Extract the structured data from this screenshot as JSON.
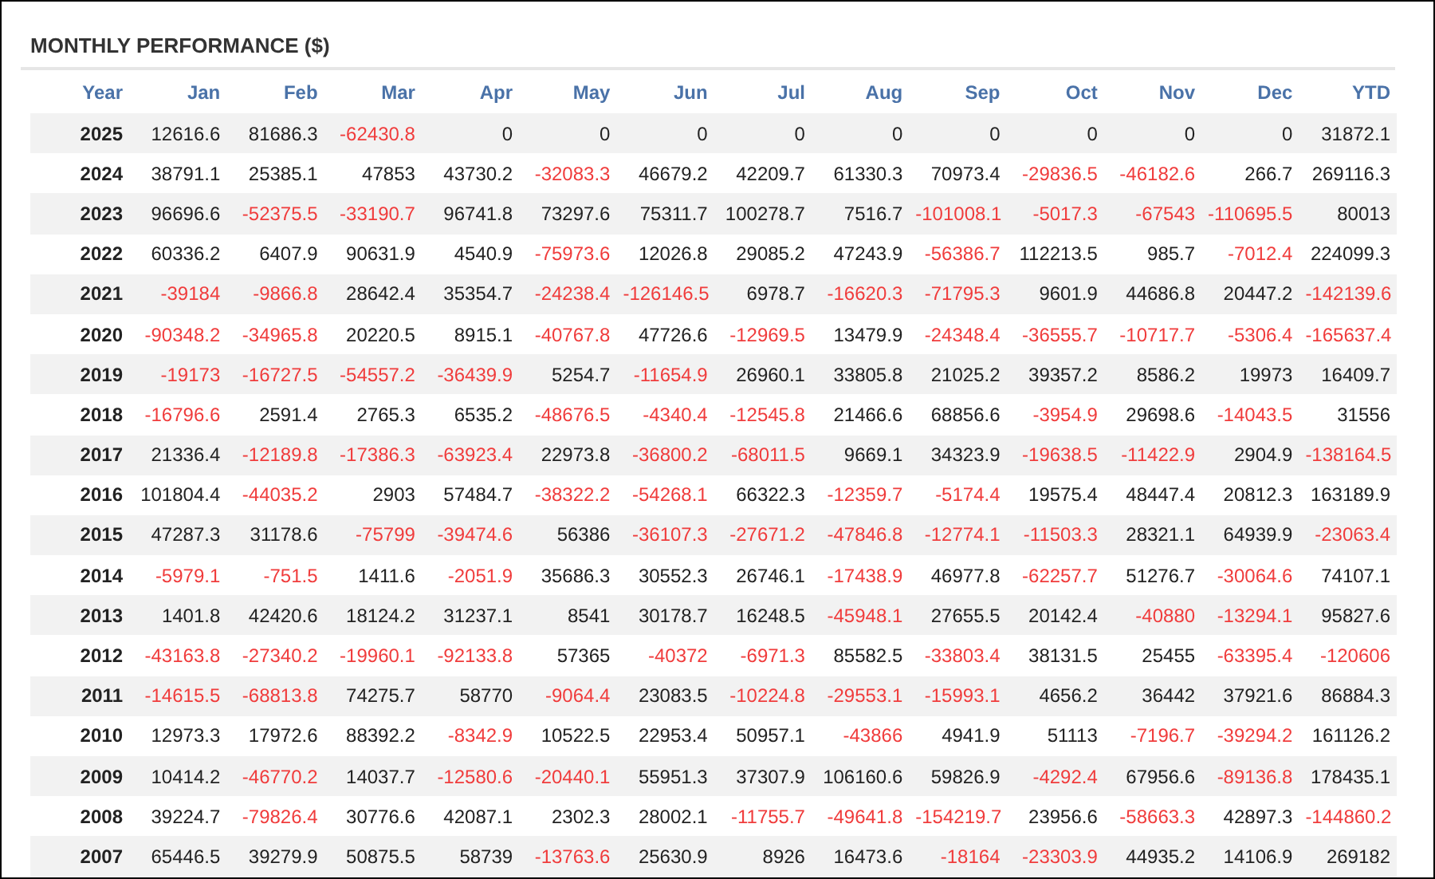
{
  "title": "MONTHLY PERFORMANCE ($)",
  "columns": [
    "Year",
    "Jan",
    "Feb",
    "Mar",
    "Apr",
    "May",
    "Jun",
    "Jul",
    "Aug",
    "Sep",
    "Oct",
    "Nov",
    "Dec",
    "YTD"
  ],
  "rows": [
    {
      "year": "2025",
      "cells": [
        {
          "text": "12616.6",
          "negative": false
        },
        {
          "text": "81686.3",
          "negative": false
        },
        {
          "text": "-62430.8",
          "negative": true
        },
        {
          "text": "0",
          "negative": false
        },
        {
          "text": "0",
          "negative": false
        },
        {
          "text": "0",
          "negative": false
        },
        {
          "text": "0",
          "negative": false
        },
        {
          "text": "0",
          "negative": false
        },
        {
          "text": "0",
          "negative": false
        },
        {
          "text": "0",
          "negative": false
        },
        {
          "text": "0",
          "negative": false
        },
        {
          "text": "0",
          "negative": false
        },
        {
          "text": "31872.1",
          "negative": false
        }
      ]
    },
    {
      "year": "2024",
      "cells": [
        {
          "text": "38791.1",
          "negative": false
        },
        {
          "text": "25385.1",
          "negative": false
        },
        {
          "text": "47853",
          "negative": false
        },
        {
          "text": "43730.2",
          "negative": false
        },
        {
          "text": "-32083.3",
          "negative": true
        },
        {
          "text": "46679.2",
          "negative": false
        },
        {
          "text": "42209.7",
          "negative": false
        },
        {
          "text": "61330.3",
          "negative": false
        },
        {
          "text": "70973.4",
          "negative": false
        },
        {
          "text": "-29836.5",
          "negative": true
        },
        {
          "text": "-46182.6",
          "negative": true
        },
        {
          "text": "266.7",
          "negative": false
        },
        {
          "text": "269116.3",
          "negative": false
        }
      ]
    },
    {
      "year": "2023",
      "cells": [
        {
          "text": "96696.6",
          "negative": false
        },
        {
          "text": "-52375.5",
          "negative": true
        },
        {
          "text": "-33190.7",
          "negative": true
        },
        {
          "text": "96741.8",
          "negative": false
        },
        {
          "text": "73297.6",
          "negative": false
        },
        {
          "text": "75311.7",
          "negative": false
        },
        {
          "text": "100278.7",
          "negative": false
        },
        {
          "text": "7516.7",
          "negative": false
        },
        {
          "text": "-101008.1",
          "negative": true
        },
        {
          "text": "-5017.3",
          "negative": true
        },
        {
          "text": "-67543",
          "negative": true
        },
        {
          "text": "-110695.5",
          "negative": true
        },
        {
          "text": "80013",
          "negative": false
        }
      ]
    },
    {
      "year": "2022",
      "cells": [
        {
          "text": "60336.2",
          "negative": false
        },
        {
          "text": "6407.9",
          "negative": false
        },
        {
          "text": "90631.9",
          "negative": false
        },
        {
          "text": "4540.9",
          "negative": false
        },
        {
          "text": "-75973.6",
          "negative": true
        },
        {
          "text": "12026.8",
          "negative": false
        },
        {
          "text": "29085.2",
          "negative": false
        },
        {
          "text": "47243.9",
          "negative": false
        },
        {
          "text": "-56386.7",
          "negative": true
        },
        {
          "text": "112213.5",
          "negative": false
        },
        {
          "text": "985.7",
          "negative": false
        },
        {
          "text": "-7012.4",
          "negative": true
        },
        {
          "text": "224099.3",
          "negative": false
        }
      ]
    },
    {
      "year": "2021",
      "cells": [
        {
          "text": "-39184",
          "negative": true
        },
        {
          "text": "-9866.8",
          "negative": true
        },
        {
          "text": "28642.4",
          "negative": false
        },
        {
          "text": "35354.7",
          "negative": false
        },
        {
          "text": "-24238.4",
          "negative": true
        },
        {
          "text": "-126146.5",
          "negative": true
        },
        {
          "text": "6978.7",
          "negative": false
        },
        {
          "text": "-16620.3",
          "negative": true
        },
        {
          "text": "-71795.3",
          "negative": true
        },
        {
          "text": "9601.9",
          "negative": false
        },
        {
          "text": "44686.8",
          "negative": false
        },
        {
          "text": "20447.2",
          "negative": false
        },
        {
          "text": "-142139.6",
          "negative": true
        }
      ]
    },
    {
      "year": "2020",
      "cells": [
        {
          "text": "-90348.2",
          "negative": true
        },
        {
          "text": "-34965.8",
          "negative": true
        },
        {
          "text": "20220.5",
          "negative": false
        },
        {
          "text": "8915.1",
          "negative": false
        },
        {
          "text": "-40767.8",
          "negative": true
        },
        {
          "text": "47726.6",
          "negative": false
        },
        {
          "text": "-12969.5",
          "negative": true
        },
        {
          "text": "13479.9",
          "negative": false
        },
        {
          "text": "-24348.4",
          "negative": true
        },
        {
          "text": "-36555.7",
          "negative": true
        },
        {
          "text": "-10717.7",
          "negative": true
        },
        {
          "text": "-5306.4",
          "negative": true
        },
        {
          "text": "-165637.4",
          "negative": true
        }
      ]
    },
    {
      "year": "2019",
      "cells": [
        {
          "text": "-19173",
          "negative": true
        },
        {
          "text": "-16727.5",
          "negative": true
        },
        {
          "text": "-54557.2",
          "negative": true
        },
        {
          "text": "-36439.9",
          "negative": true
        },
        {
          "text": "5254.7",
          "negative": false
        },
        {
          "text": "-11654.9",
          "negative": true
        },
        {
          "text": "26960.1",
          "negative": false
        },
        {
          "text": "33805.8",
          "negative": false
        },
        {
          "text": "21025.2",
          "negative": false
        },
        {
          "text": "39357.2",
          "negative": false
        },
        {
          "text": "8586.2",
          "negative": false
        },
        {
          "text": "19973",
          "negative": false
        },
        {
          "text": "16409.7",
          "negative": false
        }
      ]
    },
    {
      "year": "2018",
      "cells": [
        {
          "text": "-16796.6",
          "negative": true
        },
        {
          "text": "2591.4",
          "negative": false
        },
        {
          "text": "2765.3",
          "negative": false
        },
        {
          "text": "6535.2",
          "negative": false
        },
        {
          "text": "-48676.5",
          "negative": true
        },
        {
          "text": "-4340.4",
          "negative": true
        },
        {
          "text": "-12545.8",
          "negative": true
        },
        {
          "text": "21466.6",
          "negative": false
        },
        {
          "text": "68856.6",
          "negative": false
        },
        {
          "text": "-3954.9",
          "negative": true
        },
        {
          "text": "29698.6",
          "negative": false
        },
        {
          "text": "-14043.5",
          "negative": true
        },
        {
          "text": "31556",
          "negative": false
        }
      ]
    },
    {
      "year": "2017",
      "cells": [
        {
          "text": "21336.4",
          "negative": false
        },
        {
          "text": "-12189.8",
          "negative": true
        },
        {
          "text": "-17386.3",
          "negative": true
        },
        {
          "text": "-63923.4",
          "negative": true
        },
        {
          "text": "22973.8",
          "negative": false
        },
        {
          "text": "-36800.2",
          "negative": true
        },
        {
          "text": "-68011.5",
          "negative": true
        },
        {
          "text": "9669.1",
          "negative": false
        },
        {
          "text": "34323.9",
          "negative": false
        },
        {
          "text": "-19638.5",
          "negative": true
        },
        {
          "text": "-11422.9",
          "negative": true
        },
        {
          "text": "2904.9",
          "negative": false
        },
        {
          "text": "-138164.5",
          "negative": true
        }
      ]
    },
    {
      "year": "2016",
      "cells": [
        {
          "text": "101804.4",
          "negative": false
        },
        {
          "text": "-44035.2",
          "negative": true
        },
        {
          "text": "2903",
          "negative": false
        },
        {
          "text": "57484.7",
          "negative": false
        },
        {
          "text": "-38322.2",
          "negative": true
        },
        {
          "text": "-54268.1",
          "negative": true
        },
        {
          "text": "66322.3",
          "negative": false
        },
        {
          "text": "-12359.7",
          "negative": true
        },
        {
          "text": "-5174.4",
          "negative": true
        },
        {
          "text": "19575.4",
          "negative": false
        },
        {
          "text": "48447.4",
          "negative": false
        },
        {
          "text": "20812.3",
          "negative": false
        },
        {
          "text": "163189.9",
          "negative": false
        }
      ]
    },
    {
      "year": "2015",
      "cells": [
        {
          "text": "47287.3",
          "negative": false
        },
        {
          "text": "31178.6",
          "negative": false
        },
        {
          "text": "-75799",
          "negative": true
        },
        {
          "text": "-39474.6",
          "negative": true
        },
        {
          "text": "56386",
          "negative": false
        },
        {
          "text": "-36107.3",
          "negative": true
        },
        {
          "text": "-27671.2",
          "negative": true
        },
        {
          "text": "-47846.8",
          "negative": true
        },
        {
          "text": "-12774.1",
          "negative": true
        },
        {
          "text": "-11503.3",
          "negative": true
        },
        {
          "text": "28321.1",
          "negative": false
        },
        {
          "text": "64939.9",
          "negative": false
        },
        {
          "text": "-23063.4",
          "negative": true
        }
      ]
    },
    {
      "year": "2014",
      "cells": [
        {
          "text": "-5979.1",
          "negative": true
        },
        {
          "text": "-751.5",
          "negative": true
        },
        {
          "text": "1411.6",
          "negative": false
        },
        {
          "text": "-2051.9",
          "negative": true
        },
        {
          "text": "35686.3",
          "negative": false
        },
        {
          "text": "30552.3",
          "negative": false
        },
        {
          "text": "26746.1",
          "negative": false
        },
        {
          "text": "-17438.9",
          "negative": true
        },
        {
          "text": "46977.8",
          "negative": false
        },
        {
          "text": "-62257.7",
          "negative": true
        },
        {
          "text": "51276.7",
          "negative": false
        },
        {
          "text": "-30064.6",
          "negative": true
        },
        {
          "text": "74107.1",
          "negative": false
        }
      ]
    },
    {
      "year": "2013",
      "cells": [
        {
          "text": "1401.8",
          "negative": false
        },
        {
          "text": "42420.6",
          "negative": false
        },
        {
          "text": "18124.2",
          "negative": false
        },
        {
          "text": "31237.1",
          "negative": false
        },
        {
          "text": "8541",
          "negative": false
        },
        {
          "text": "30178.7",
          "negative": false
        },
        {
          "text": "16248.5",
          "negative": false
        },
        {
          "text": "-45948.1",
          "negative": true
        },
        {
          "text": "27655.5",
          "negative": false
        },
        {
          "text": "20142.4",
          "negative": false
        },
        {
          "text": "-40880",
          "negative": true
        },
        {
          "text": "-13294.1",
          "negative": true
        },
        {
          "text": "95827.6",
          "negative": false
        }
      ]
    },
    {
      "year": "2012",
      "cells": [
        {
          "text": "-43163.8",
          "negative": true
        },
        {
          "text": "-27340.2",
          "negative": true
        },
        {
          "text": "-19960.1",
          "negative": true
        },
        {
          "text": "-92133.8",
          "negative": true
        },
        {
          "text": "57365",
          "negative": false
        },
        {
          "text": "-40372",
          "negative": true
        },
        {
          "text": "-6971.3",
          "negative": true
        },
        {
          "text": "85582.5",
          "negative": false
        },
        {
          "text": "-33803.4",
          "negative": true
        },
        {
          "text": "38131.5",
          "negative": false
        },
        {
          "text": "25455",
          "negative": false
        },
        {
          "text": "-63395.4",
          "negative": true
        },
        {
          "text": "-120606",
          "negative": true
        }
      ]
    },
    {
      "year": "2011",
      "cells": [
        {
          "text": "-14615.5",
          "negative": true
        },
        {
          "text": "-68813.8",
          "negative": true
        },
        {
          "text": "74275.7",
          "negative": false
        },
        {
          "text": "58770",
          "negative": false
        },
        {
          "text": "-9064.4",
          "negative": true
        },
        {
          "text": "23083.5",
          "negative": false
        },
        {
          "text": "-10224.8",
          "negative": true
        },
        {
          "text": "-29553.1",
          "negative": true
        },
        {
          "text": "-15993.1",
          "negative": true
        },
        {
          "text": "4656.2",
          "negative": false
        },
        {
          "text": "36442",
          "negative": false
        },
        {
          "text": "37921.6",
          "negative": false
        },
        {
          "text": "86884.3",
          "negative": false
        }
      ]
    },
    {
      "year": "2010",
      "cells": [
        {
          "text": "12973.3",
          "negative": false
        },
        {
          "text": "17972.6",
          "negative": false
        },
        {
          "text": "88392.2",
          "negative": false
        },
        {
          "text": "-8342.9",
          "negative": true
        },
        {
          "text": "10522.5",
          "negative": false
        },
        {
          "text": "22953.4",
          "negative": false
        },
        {
          "text": "50957.1",
          "negative": false
        },
        {
          "text": "-43866",
          "negative": true
        },
        {
          "text": "4941.9",
          "negative": false
        },
        {
          "text": "51113",
          "negative": false
        },
        {
          "text": "-7196.7",
          "negative": true
        },
        {
          "text": "-39294.2",
          "negative": true
        },
        {
          "text": "161126.2",
          "negative": false
        }
      ]
    },
    {
      "year": "2009",
      "cells": [
        {
          "text": "10414.2",
          "negative": false
        },
        {
          "text": "-46770.2",
          "negative": true
        },
        {
          "text": "14037.7",
          "negative": false
        },
        {
          "text": "-12580.6",
          "negative": true
        },
        {
          "text": "-20440.1",
          "negative": true
        },
        {
          "text": "55951.3",
          "negative": false
        },
        {
          "text": "37307.9",
          "negative": false
        },
        {
          "text": "106160.6",
          "negative": false
        },
        {
          "text": "59826.9",
          "negative": false
        },
        {
          "text": "-4292.4",
          "negative": true
        },
        {
          "text": "67956.6",
          "negative": false
        },
        {
          "text": "-89136.8",
          "negative": true
        },
        {
          "text": "178435.1",
          "negative": false
        }
      ]
    },
    {
      "year": "2008",
      "cells": [
        {
          "text": "39224.7",
          "negative": false
        },
        {
          "text": "-79826.4",
          "negative": true
        },
        {
          "text": "30776.6",
          "negative": false
        },
        {
          "text": "42087.1",
          "negative": false
        },
        {
          "text": "2302.3",
          "negative": false
        },
        {
          "text": "28002.1",
          "negative": false
        },
        {
          "text": "-11755.7",
          "negative": true
        },
        {
          "text": "-49641.8",
          "negative": true
        },
        {
          "text": "-154219.7",
          "negative": true
        },
        {
          "text": "23956.6",
          "negative": false
        },
        {
          "text": "-58663.3",
          "negative": true
        },
        {
          "text": "42897.3",
          "negative": false
        },
        {
          "text": "-144860.2",
          "negative": true
        }
      ]
    },
    {
      "year": "2007",
      "cells": [
        {
          "text": "65446.5",
          "negative": false
        },
        {
          "text": "39279.9",
          "negative": false
        },
        {
          "text": "50875.5",
          "negative": false
        },
        {
          "text": "58739",
          "negative": false
        },
        {
          "text": "-13763.6",
          "negative": true
        },
        {
          "text": "25630.9",
          "negative": false
        },
        {
          "text": "8926",
          "negative": false
        },
        {
          "text": "16473.6",
          "negative": false
        },
        {
          "text": "-18164",
          "negative": true
        },
        {
          "text": "-23303.9",
          "negative": true
        },
        {
          "text": "44935.2",
          "negative": false
        },
        {
          "text": "14106.9",
          "negative": false
        },
        {
          "text": "269182",
          "negative": false
        }
      ]
    }
  ]
}
